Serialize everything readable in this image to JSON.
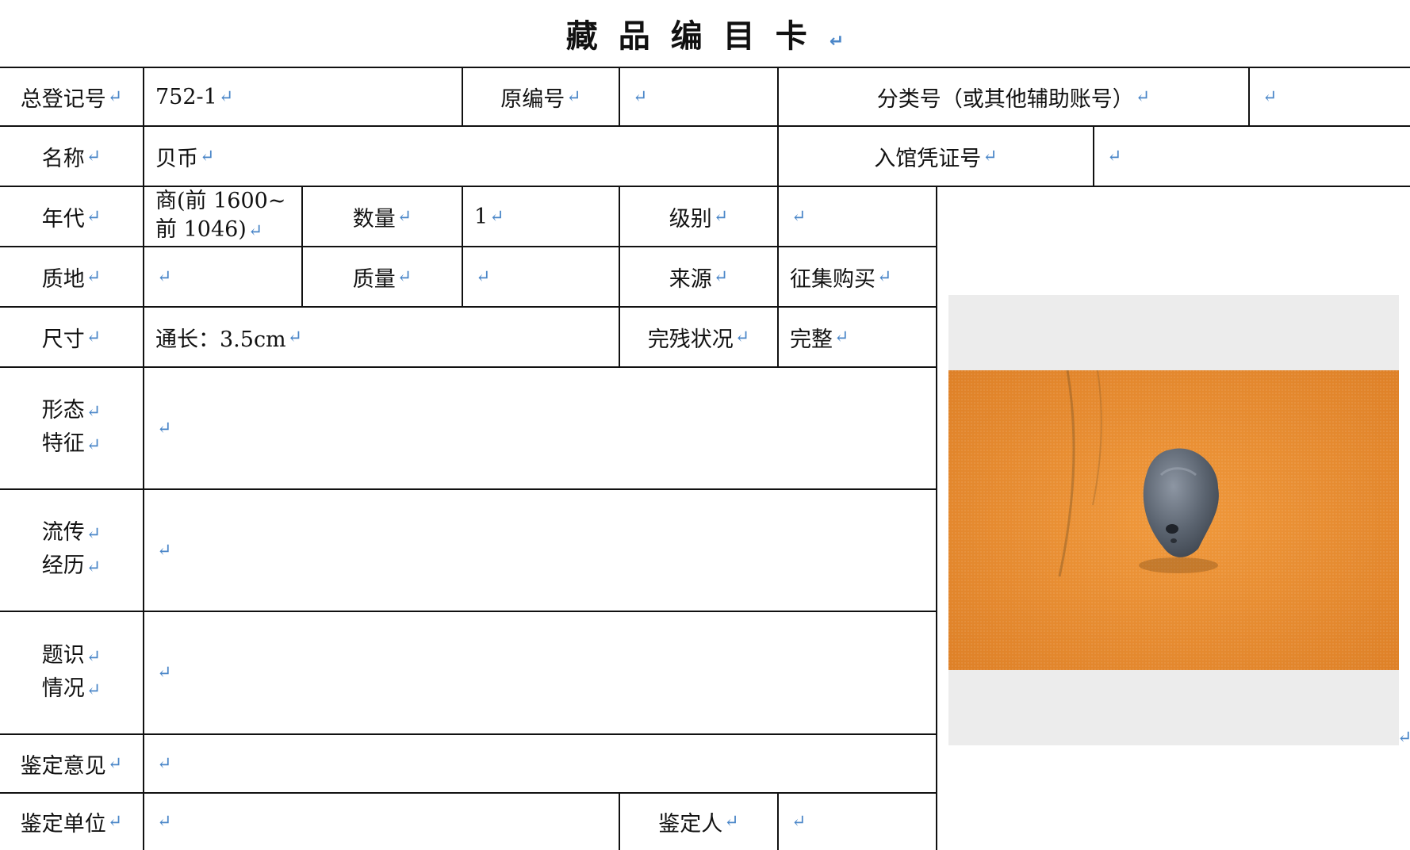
{
  "title": "藏品编目卡",
  "return_mark": "↵",
  "row1": {
    "reg_label": "总登记号",
    "reg_value": "752-1",
    "orig_label": "原编号",
    "orig_value": "",
    "class_label": "分类号（或其他辅助账号）",
    "class_value": ""
  },
  "row2": {
    "name_label": "名称",
    "name_value": "贝币",
    "entry_label": "入馆凭证号",
    "entry_value": ""
  },
  "row3": {
    "era_label": "年代",
    "era_value_1": "商(前 1600~",
    "era_value_2": "前 1046)",
    "qty_label": "数量",
    "qty_value": "1",
    "grade_label": "级别",
    "grade_value": ""
  },
  "row4": {
    "material_label": "质地",
    "material_value": "",
    "mass_label": "质量",
    "mass_value": "",
    "source_label": "来源",
    "source_value": "征集购买"
  },
  "row5": {
    "size_label": "尺寸",
    "size_value": "通长：3.5cm",
    "condition_label": "完残状况",
    "condition_value": "完整"
  },
  "row6": {
    "label_1": "形态",
    "label_2": "特征",
    "value": ""
  },
  "row7": {
    "label_1": "流传",
    "label_2": "经历",
    "value": ""
  },
  "row8": {
    "label_1": "题识",
    "label_2": "情况",
    "value": ""
  },
  "row9": {
    "label": "鉴定意见",
    "value": ""
  },
  "row10": {
    "unit_label": "鉴定单位",
    "unit_value": "",
    "person_label": "鉴定人",
    "person_value": ""
  },
  "photo": {
    "subject": "shell-coin-photo",
    "background_color": "#e58a2e",
    "object_color": "#5d6673"
  }
}
